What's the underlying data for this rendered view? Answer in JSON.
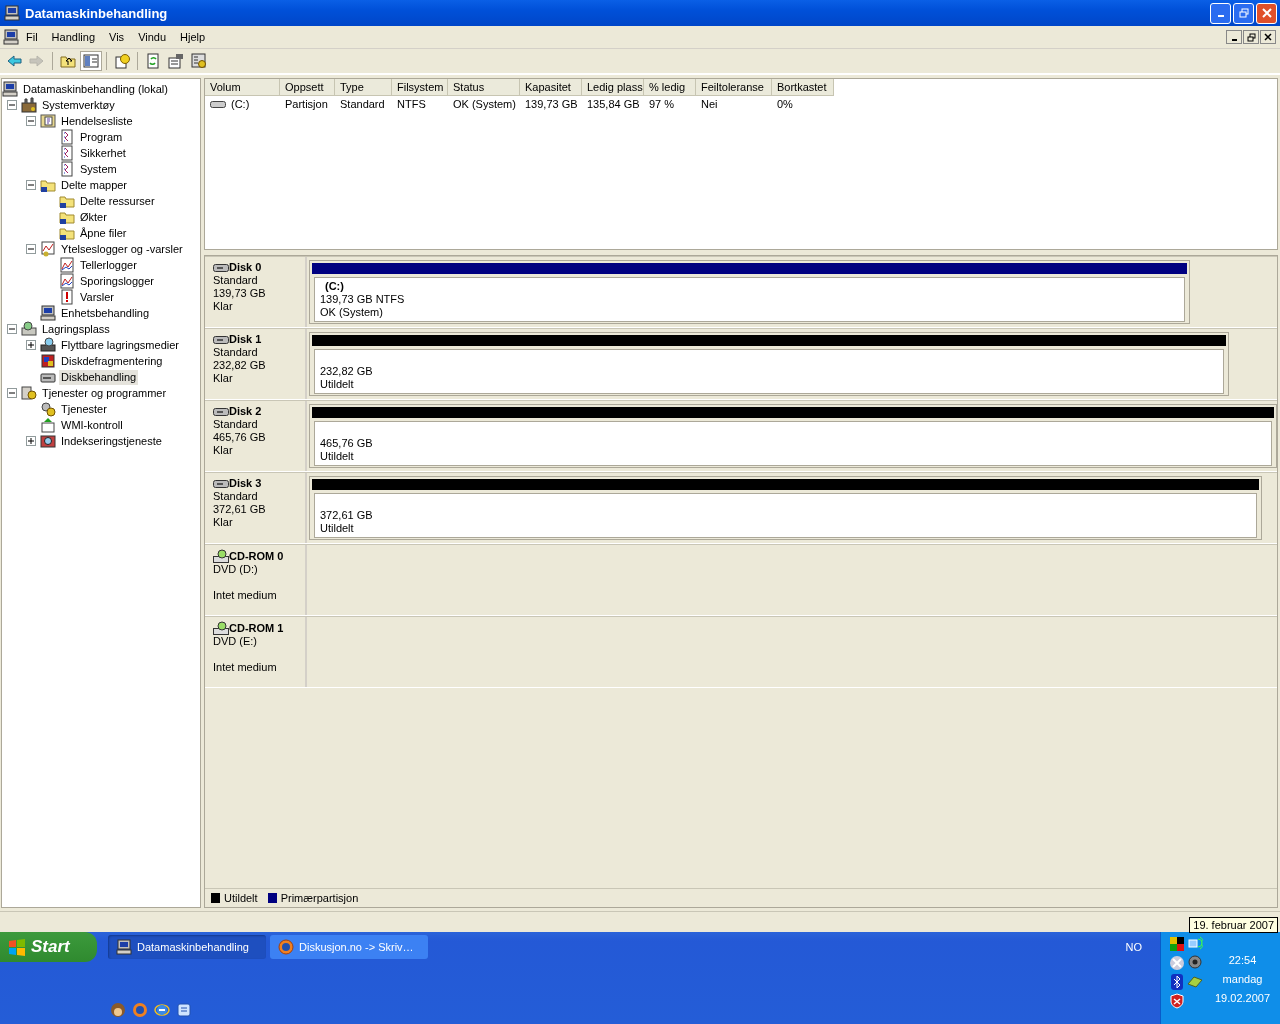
{
  "window": {
    "title": "Datamaskinbehandling"
  },
  "menu": [
    "Fil",
    "Handling",
    "Vis",
    "Vindu",
    "Hjelp"
  ],
  "toolbar": [
    {
      "kind": "back",
      "disabled": false,
      "pressed": false
    },
    {
      "kind": "forward",
      "disabled": true,
      "pressed": false
    },
    {
      "kind": "separator"
    },
    {
      "kind": "up",
      "disabled": false,
      "pressed": false
    },
    {
      "kind": "tree",
      "disabled": false,
      "pressed": true
    },
    {
      "kind": "separator"
    },
    {
      "kind": "help",
      "disabled": false,
      "pressed": false
    },
    {
      "kind": "separator"
    },
    {
      "kind": "refresh",
      "disabled": false,
      "pressed": false
    },
    {
      "kind": "properties",
      "disabled": false,
      "pressed": false
    },
    {
      "kind": "settings",
      "disabled": false,
      "pressed": false
    }
  ],
  "tree": {
    "label": "Datamaskinbehandling (lokal)",
    "kind": "computer",
    "selected": false,
    "children": [
      {
        "label": "Systemverktøy",
        "kind": "tools",
        "selected": false,
        "expanded": true,
        "children": [
          {
            "label": "Hendelsesliste",
            "kind": "eventlog",
            "selected": false,
            "expanded": true,
            "children": [
              {
                "label": "Program",
                "kind": "log",
                "selected": false
              },
              {
                "label": "Sikkerhet",
                "kind": "log",
                "selected": false
              },
              {
                "label": "System",
                "kind": "log",
                "selected": false
              }
            ]
          },
          {
            "label": "Delte mapper",
            "kind": "folder",
            "selected": false,
            "expanded": true,
            "children": [
              {
                "label": "Delte ressurser",
                "kind": "folder",
                "selected": false
              },
              {
                "label": "Økter",
                "kind": "folder",
                "selected": false
              },
              {
                "label": "Åpne filer",
                "kind": "folder",
                "selected": false
              }
            ]
          },
          {
            "label": "Ytelseslogger og -varsler",
            "kind": "perf",
            "selected": false,
            "expanded": true,
            "children": [
              {
                "label": "Tellerlogger",
                "kind": "chart",
                "selected": false
              },
              {
                "label": "Sporingslogger",
                "kind": "chart",
                "selected": false
              },
              {
                "label": "Varsler",
                "kind": "alert",
                "selected": false
              }
            ]
          },
          {
            "label": "Enhetsbehandling",
            "kind": "computer",
            "selected": false
          }
        ]
      },
      {
        "label": "Lagringsplass",
        "kind": "storage",
        "selected": false,
        "expanded": true,
        "children": [
          {
            "label": "Flyttbare lagringsmedier",
            "kind": "removable",
            "selected": false,
            "expanded": false
          },
          {
            "label": "Diskdefragmentering",
            "kind": "defrag",
            "selected": false
          },
          {
            "label": "Diskbehandling",
            "kind": "disk",
            "selected": true
          }
        ]
      },
      {
        "label": "Tjenester og programmer",
        "kind": "services",
        "selected": false,
        "expanded": true,
        "children": [
          {
            "label": "Tjenester",
            "kind": "gear",
            "selected": false
          },
          {
            "label": "WMI-kontroll",
            "kind": "wmi",
            "selected": false
          },
          {
            "label": "Indekseringstjeneste",
            "kind": "index",
            "selected": false,
            "expanded": false
          }
        ]
      }
    ]
  },
  "table": {
    "columns": [
      "Volum",
      "Oppsett",
      "Type",
      "Filsystem",
      "Status",
      "Kapasitet",
      "Ledig plass",
      "% ledig",
      "Feiltoleranse",
      "Bortkastet"
    ],
    "rows": [
      {
        "cells": [
          "(C:)",
          "Partisjon",
          "Standard",
          "NTFS",
          "OK (System)",
          "139,73 GB",
          "135,84 GB",
          "97 %",
          "Nei",
          "0%"
        ]
      }
    ]
  },
  "disks": [
    {
      "kind": "disk",
      "name": "Disk 0",
      "type": "Standard",
      "size": "139,73 GB",
      "status": "Klar",
      "partitions": [
        {
          "kind": "primary",
          "label": "(C:)",
          "size": "139,73 GB NTFS",
          "status": "OK (System)"
        }
      ]
    },
    {
      "kind": "disk",
      "name": "Disk 1",
      "type": "Standard",
      "size": "232,82 GB",
      "status": "Klar",
      "partitions": [
        {
          "kind": "unallocated",
          "size": "232,82 GB",
          "status": "Utildelt"
        }
      ]
    },
    {
      "kind": "disk",
      "name": "Disk 2",
      "type": "Standard",
      "size": "465,76 GB",
      "status": "Klar",
      "partitions": [
        {
          "kind": "unallocated",
          "size": "465,76 GB",
          "status": "Utildelt"
        }
      ]
    },
    {
      "kind": "disk",
      "name": "Disk 3",
      "type": "Standard",
      "size": "372,61 GB",
      "status": "Klar",
      "partitions": [
        {
          "kind": "unallocated",
          "size": "372,61 GB",
          "status": "Utildelt"
        }
      ]
    },
    {
      "kind": "cdrom",
      "name": "CD-ROM 0",
      "type": "DVD (D:)",
      "status": "Intet medium"
    },
    {
      "kind": "cdrom",
      "name": "CD-ROM 1",
      "type": "DVD (E:)",
      "status": "Intet medium"
    }
  ],
  "legend": [
    {
      "label": "Utildelt",
      "color": "#000000"
    },
    {
      "label": "Primærpartisjon",
      "color": "#000080"
    }
  ],
  "taskbar": {
    "start": "Start",
    "tasks": [
      {
        "label": "Datamaskinbehandling",
        "kind": "computer",
        "selected": true
      },
      {
        "label": "Diskusjon.no -> Skriv…",
        "kind": "browser",
        "selected": false
      }
    ],
    "language": "NO",
    "time": "22:54",
    "day": "mandag",
    "date": "19.02.2007"
  },
  "tooltip": "19. februar 2007"
}
